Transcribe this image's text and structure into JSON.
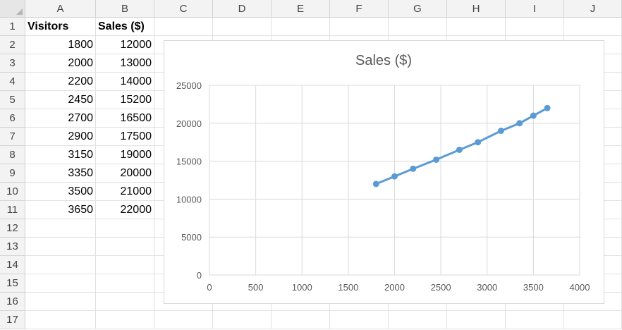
{
  "columns": [
    "A",
    "B",
    "C",
    "D",
    "E",
    "F",
    "G",
    "H",
    "I",
    "J"
  ],
  "rows": [
    "1",
    "2",
    "3",
    "4",
    "5",
    "6",
    "7",
    "8",
    "9",
    "10",
    "11",
    "12",
    "13",
    "14",
    "15",
    "16",
    "17"
  ],
  "table": {
    "headers": [
      "Visitors",
      "Sales ($)"
    ],
    "visitors": [
      "1800",
      "2000",
      "2200",
      "2450",
      "2700",
      "2900",
      "3150",
      "3350",
      "3500",
      "3650"
    ],
    "sales": [
      "12000",
      "13000",
      "14000",
      "15200",
      "16500",
      "17500",
      "19000",
      "20000",
      "21000",
      "22000"
    ]
  },
  "chart_data": {
    "type": "line",
    "title": "Sales ($)",
    "x": [
      1800,
      2000,
      2200,
      2450,
      2700,
      2900,
      3150,
      3350,
      3500,
      3650
    ],
    "series": [
      {
        "values": [
          12000,
          13000,
          14000,
          15200,
          16500,
          17500,
          19000,
          20000,
          21000,
          22000
        ],
        "color": "#5b9bd5"
      }
    ],
    "xlim": [
      0,
      4000
    ],
    "ylim": [
      0,
      25000
    ],
    "x_ticks": [
      "0",
      "500",
      "1000",
      "1500",
      "2000",
      "2500",
      "3000",
      "3500",
      "4000"
    ],
    "y_ticks": [
      "0",
      "5000",
      "10000",
      "15000",
      "20000",
      "25000"
    ],
    "grid": true,
    "xlabel": "",
    "ylabel": ""
  },
  "colors": {
    "series": "#5b9bd5",
    "grid": "#d9d9d9",
    "header_bg": "#f3f3f3"
  }
}
